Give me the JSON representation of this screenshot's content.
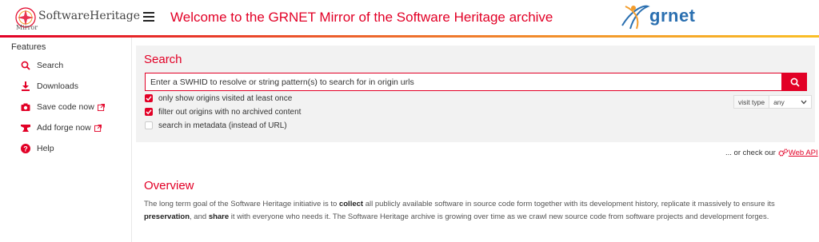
{
  "header": {
    "logo_title": "SoftwareHeritage",
    "logo_subtitle": "Mirror",
    "page_title": "Welcome to the GRNET Mirror of the Software Heritage archive",
    "partner_logo_text": "grnet",
    "accent_color": "#e20026"
  },
  "sidebar": {
    "heading": "Features",
    "items": [
      {
        "label": "Search",
        "icon": "search-icon"
      },
      {
        "label": "Downloads",
        "icon": "download-icon"
      },
      {
        "label": "Save code now",
        "icon": "camera-icon",
        "external": true
      },
      {
        "label": "Add forge now",
        "icon": "anvil-icon",
        "external": true
      },
      {
        "label": "Help",
        "icon": "help-icon"
      }
    ]
  },
  "search": {
    "heading": "Search",
    "placeholder": "Enter a SWHID to resolve or string pattern(s) to search for in origin urls",
    "value": "",
    "options": [
      {
        "label": "only show origins visited at least once",
        "checked": true
      },
      {
        "label": "filter out origins with no archived content",
        "checked": true
      },
      {
        "label": "search in metadata (instead of URL)",
        "checked": false
      }
    ],
    "visit_type_label": "visit type",
    "visit_type_value": "any"
  },
  "api": {
    "prefix": "... or check our",
    "link_label": "Web API"
  },
  "overview": {
    "heading": "Overview",
    "p1": "The long term goal of the Software Heritage initiative is to ",
    "b1": "collect",
    "p2": " all publicly available software in source code form together with its development history, replicate it massively to ensure its ",
    "b2": "preservation",
    "p3": ", and ",
    "b3": "share",
    "p4": " it with everyone who needs it. The Software Heritage archive is growing over time as we crawl new source code from software projects and development forges."
  }
}
